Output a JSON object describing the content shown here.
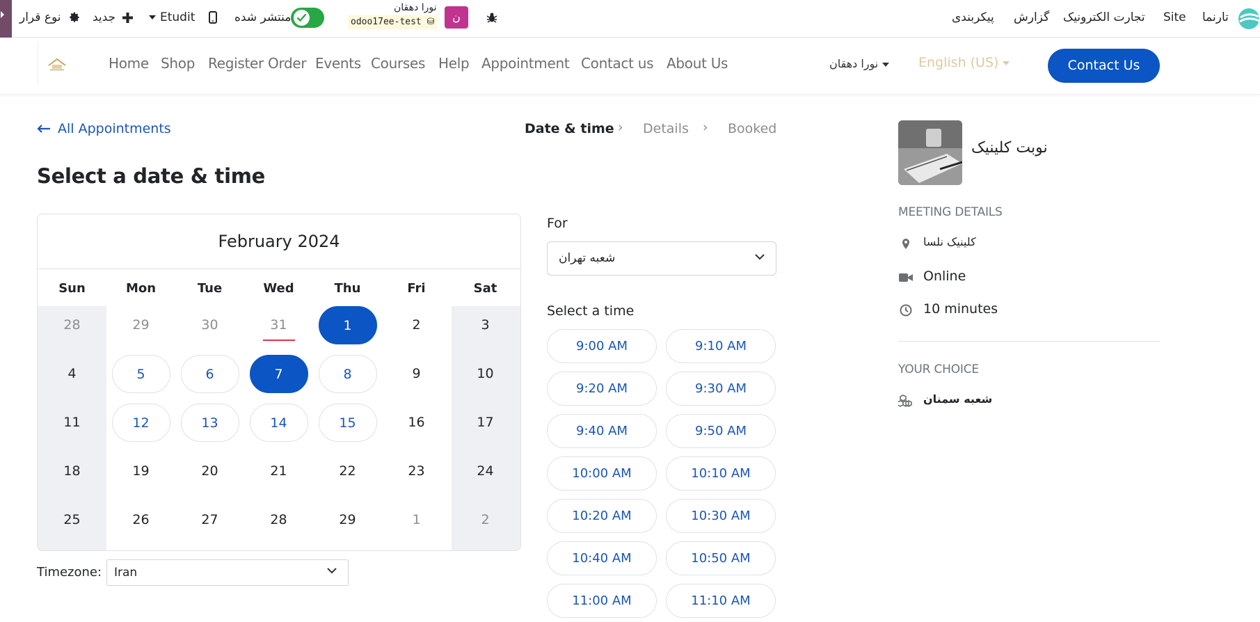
{
  "topbar": {
    "brand": "تارنما",
    "menu": [
      "Site",
      "تجارت الکترونیک",
      "گزارش",
      "پیکربندی"
    ],
    "user_name": "نورا دهقان",
    "db_name": "odoo17ee-test",
    "avatar_letter": "ن",
    "published_label": "منتشر شده",
    "edit_label": "Etudit",
    "new_label": "جدید",
    "type_label": "نوع قرار"
  },
  "header": {
    "nav": [
      "Home",
      "Shop",
      "Register Order",
      "Events",
      "Courses",
      "Help",
      "Appointment",
      "Contact us",
      "About Us"
    ],
    "user_menu": "نورا دهقان",
    "language": "English (US)",
    "contact_button": "Contact Us"
  },
  "main": {
    "back_link": "All Appointments",
    "steps": [
      "Date & time",
      "Details",
      "Booked"
    ],
    "title": "Select a date & time",
    "calendar": {
      "month": "February 2024",
      "weekdays": [
        "Sun",
        "Mon",
        "Tue",
        "Wed",
        "Thu",
        "Fri",
        "Sat"
      ],
      "weeks": [
        [
          {
            "d": "28",
            "s": "muted"
          },
          {
            "d": "29",
            "s": "muted"
          },
          {
            "d": "30",
            "s": "muted"
          },
          {
            "d": "31",
            "s": "muted today"
          },
          {
            "d": "1",
            "s": "selected"
          },
          {
            "d": "2",
            "s": "plain"
          },
          {
            "d": "3",
            "s": "plain"
          }
        ],
        [
          {
            "d": "4",
            "s": "plain"
          },
          {
            "d": "5",
            "s": "avail"
          },
          {
            "d": "6",
            "s": "avail"
          },
          {
            "d": "7",
            "s": "selected"
          },
          {
            "d": "8",
            "s": "avail"
          },
          {
            "d": "9",
            "s": "plain"
          },
          {
            "d": "10",
            "s": "plain"
          }
        ],
        [
          {
            "d": "11",
            "s": "plain"
          },
          {
            "d": "12",
            "s": "avail"
          },
          {
            "d": "13",
            "s": "avail"
          },
          {
            "d": "14",
            "s": "avail"
          },
          {
            "d": "15",
            "s": "avail"
          },
          {
            "d": "16",
            "s": "plain"
          },
          {
            "d": "17",
            "s": "plain"
          }
        ],
        [
          {
            "d": "18",
            "s": "plain"
          },
          {
            "d": "19",
            "s": "plain"
          },
          {
            "d": "20",
            "s": "plain"
          },
          {
            "d": "21",
            "s": "plain"
          },
          {
            "d": "22",
            "s": "plain"
          },
          {
            "d": "23",
            "s": "plain"
          },
          {
            "d": "24",
            "s": "plain"
          }
        ],
        [
          {
            "d": "25",
            "s": "plain"
          },
          {
            "d": "26",
            "s": "plain"
          },
          {
            "d": "27",
            "s": "plain"
          },
          {
            "d": "28",
            "s": "plain"
          },
          {
            "d": "29",
            "s": "plain"
          },
          {
            "d": "1",
            "s": "muted"
          },
          {
            "d": "2",
            "s": "muted"
          }
        ]
      ]
    },
    "timezone_label": "Timezone:",
    "timezone_value": "Iran",
    "for_label": "For",
    "for_value": "شعبه تهران",
    "select_time_label": "Select a time",
    "slots": [
      "9:00 AM",
      "9:10 AM",
      "9:20 AM",
      "9:30 AM",
      "9:40 AM",
      "9:50 AM",
      "10:00 AM",
      "10:10 AM",
      "10:20 AM",
      "10:30 AM",
      "10:40 AM",
      "10:50 AM",
      "11:00 AM",
      "11:10 AM"
    ]
  },
  "aside": {
    "appointment_name": "نوبت کلینیک",
    "meeting_details_label": "MEETING DETAILS",
    "location": "کلینیک نلسا",
    "mode": "Online",
    "duration": "10 minutes",
    "your_choice_label": "YOUR CHOICE",
    "choice": "شعبه سمنان"
  },
  "colors": {
    "primary": "#0B55C4",
    "link": "#1a56b8",
    "odoo_purple": "#714B67",
    "published_green": "#28a745",
    "today_marker": "#dc3545"
  }
}
